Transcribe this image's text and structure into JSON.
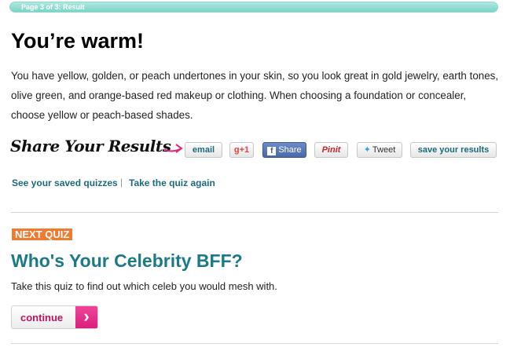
{
  "progress": {
    "label": "Page 3 of 3: Result",
    "fraction": 1.0
  },
  "result": {
    "title": "You’re warm!",
    "description": "You have yellow, golden, or peach undertones in your skin, so you look great in gold jewelry, earth tones, olive green, and orange-based red makeup or clothing. When choosing a foundation or concealer, choose yellow or peach-based shades."
  },
  "share": {
    "title": "Share Your Results",
    "buttons": {
      "email": "email",
      "gplus": "g+1",
      "facebook_icon": "f",
      "facebook": "Share",
      "pinterest": "Pinit",
      "twitter_icon": "✦",
      "twitter": "Tweet",
      "save": "save your results"
    },
    "icons": [
      "arrow-icon",
      "facebook-icon",
      "twitter-bird-icon",
      "pinterest-icon",
      "google-plus-icon"
    ]
  },
  "links": {
    "saved_quizzes": "See your saved quizzes",
    "separator": "|",
    "take_again": "Take the quiz again"
  },
  "next_quiz": {
    "badge": "NEXT QUIZ",
    "title": "Who's Your Celebrity BFF?",
    "description": "Take this quiz to find out which celeb you would mesh with.",
    "continue_label": "continue",
    "continue_icon": "›"
  },
  "colors": {
    "progress": "#7dd3c7",
    "link": "#1b6a7a",
    "next_title": "#1b7a86",
    "badge": "#f07a30",
    "continue_accent": "#d9207d"
  }
}
